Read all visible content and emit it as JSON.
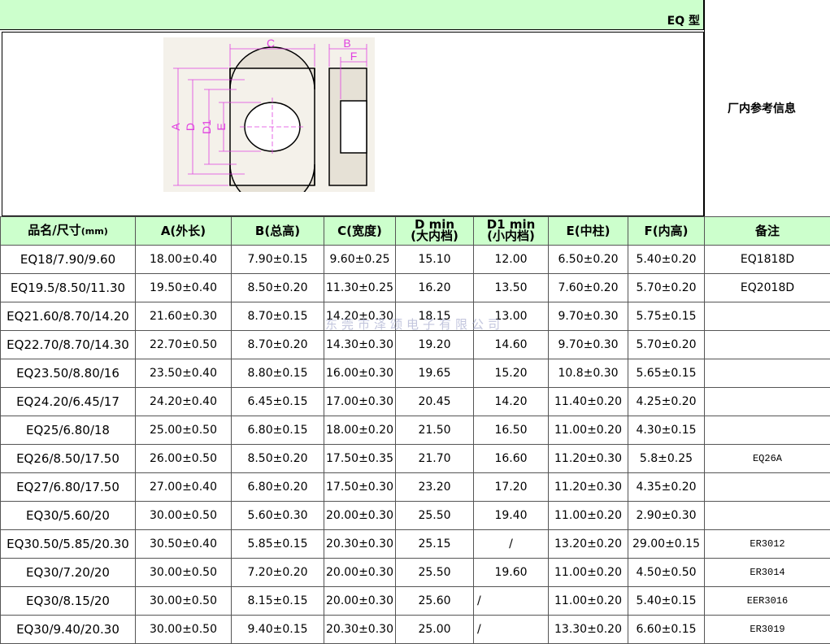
{
  "type_label": "EQ 型",
  "side_info": "厂内参考信息",
  "drawing": {
    "labels": {
      "c": "C",
      "b": "B",
      "f": "F",
      "a": "A",
      "d": "D",
      "d1": "D1",
      "e": "E"
    }
  },
  "watermark": "东莞市泽颂电子有限公司",
  "headers": [
    {
      "line1": "品名/尺寸",
      "unit": "(mm)"
    },
    {
      "line1": "A(外长)"
    },
    {
      "line1": "B(总高)"
    },
    {
      "line1": "C(宽度)"
    },
    {
      "line1": "D min",
      "line2": "(大内档)"
    },
    {
      "line1": "D1 min",
      "line2": "(小内档)"
    },
    {
      "line1": "E(中柱)"
    },
    {
      "line1": "F(内高)"
    },
    {
      "line1": "备注"
    }
  ],
  "rows": [
    {
      "name": "EQ18/7.90/9.60",
      "a": "18.00±0.40",
      "b": "7.90±0.15",
      "c": "9.60±0.25",
      "d": "15.10",
      "d1": "12.00",
      "e": "6.50±0.20",
      "f": "5.40±0.20",
      "note": "EQ1818D"
    },
    {
      "name": "EQ19.5/8.50/11.30",
      "a": "19.50±0.40",
      "b": "8.50±0.20",
      "c": "11.30±0.25",
      "d": "16.20",
      "d1": "13.50",
      "e": "7.60±0.20",
      "f": "5.70±0.20",
      "note": "EQ2018D"
    },
    {
      "name": "EQ21.60/8.70/14.20",
      "a": "21.60±0.30",
      "b": "8.70±0.15",
      "c": "14.20±0.30",
      "d": "18.15",
      "d1": "13.00",
      "e": "9.70±0.30",
      "f": "5.75±0.15",
      "note": ""
    },
    {
      "name": "EQ22.70/8.70/14.30",
      "a": "22.70±0.50",
      "b": "8.70±0.20",
      "c": "14.30±0.30",
      "d": "19.20",
      "d1": "14.60",
      "e": "9.70±0.30",
      "f": "5.70±0.20",
      "note": ""
    },
    {
      "name": "EQ23.50/8.80/16",
      "a": "23.50±0.40",
      "b": "8.80±0.15",
      "c": "16.00±0.30",
      "d": "19.65",
      "d1": "15.20",
      "e": "10.8±0.30",
      "f": "5.65±0.15",
      "note": ""
    },
    {
      "name": "EQ24.20/6.45/17",
      "a": "24.20±0.40",
      "b": "6.45±0.15",
      "c": "17.00±0.30",
      "d": "20.45",
      "d1": "14.20",
      "e": "11.40±0.20",
      "f": "4.25±0.20",
      "note": ""
    },
    {
      "name": "EQ25/6.80/18",
      "a": "25.00±0.50",
      "b": "6.80±0.15",
      "c": "18.00±0.20",
      "d": "21.50",
      "d1": "16.50",
      "e": "11.00±0.20",
      "f": "4.30±0.15",
      "note": ""
    },
    {
      "name": "EQ26/8.50/17.50",
      "a": "26.00±0.50",
      "b": "8.50±0.20",
      "c": "17.50±0.35",
      "d": "21.70",
      "d1": "16.60",
      "e": "11.20±0.30",
      "f": "5.8±0.25",
      "note": "EQ26A"
    },
    {
      "name": "EQ27/6.80/17.50",
      "a": "27.00±0.40",
      "b": "6.80±0.20",
      "c": "17.50±0.30",
      "d": "23.20",
      "d1": "17.20",
      "e": "11.20±0.30",
      "f": "4.35±0.20",
      "note": ""
    },
    {
      "name": "EQ30/5.60/20",
      "a": "30.00±0.50",
      "b": "5.60±0.30",
      "c": "20.00±0.30",
      "d": "25.50",
      "d1": "19.40",
      "e": "11.00±0.20",
      "f": "2.90±0.30",
      "note": ""
    },
    {
      "name": "EQ30.50/5.85/20.30",
      "a": "30.50±0.40",
      "b": "5.85±0.15",
      "c": "20.30±0.30",
      "d": "25.15",
      "d1": "/",
      "e": "13.20±0.20",
      "f": "29.00±0.15",
      "note": "ER3012"
    },
    {
      "name": "EQ30/7.20/20",
      "a": "30.00±0.50",
      "b": "7.20±0.20",
      "c": "20.00±0.30",
      "d": "25.50",
      "d1": "19.60",
      "e": "11.00±0.20",
      "f": "4.50±0.50",
      "note": "ER3014"
    },
    {
      "name": "EQ30/8.15/20",
      "a": "30.00±0.50",
      "b": "8.15±0.15",
      "c": "20.00±0.30",
      "d": "25.60",
      "d1": "/",
      "e": "11.00±0.20",
      "f": "5.40±0.15",
      "note": "EER3016"
    },
    {
      "name": "EQ30/9.40/20.30",
      "a": "30.00±0.50",
      "b": "9.40±0.15",
      "c": "20.30±0.30",
      "d": "25.00",
      "d1": "/",
      "e": "13.30±0.20",
      "f": "6.60±0.15",
      "note": "ER3019"
    }
  ],
  "colors": {
    "header_bg": "#ccffcc",
    "dim_line": "#e040e0",
    "core_fill": "#f0ece4"
  }
}
